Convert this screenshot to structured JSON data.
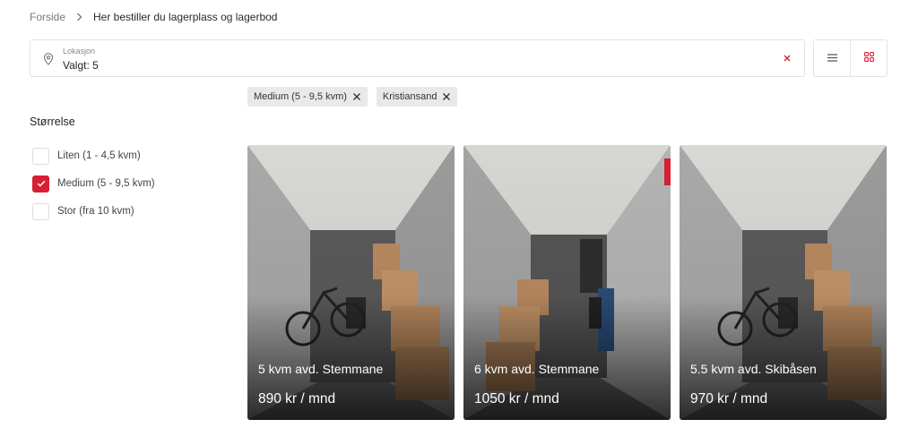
{
  "breadcrumb": {
    "home": "Forside",
    "separator_icon": "chevron-right-icon",
    "current": "Her bestiller du lagerplass og lagerbod"
  },
  "location": {
    "label": "Lokasjon",
    "value": "Valgt: 5",
    "icon": "map-pin-icon",
    "clear_icon": "close-icon"
  },
  "view_toggle": {
    "list_icon": "list-view-icon",
    "grid_icon": "grid-view-icon",
    "active": "grid"
  },
  "active_filters": [
    {
      "label": "Medium (5 - 9,5 kvm)"
    },
    {
      "label": "Kristiansand"
    }
  ],
  "size_filter": {
    "title": "Størrelse",
    "options": [
      {
        "label": "Liten (1 - 4,5 kvm)",
        "checked": false
      },
      {
        "label": "Medium (5 - 9,5 kvm)",
        "checked": true
      },
      {
        "label": "Stor (fra 10 kvm)",
        "checked": false
      }
    ]
  },
  "units": [
    {
      "title": "5 kvm avd. Stemmane",
      "price": "890 kr / mnd"
    },
    {
      "title": "6 kvm avd. Stemmane",
      "price": "1050 kr / mnd"
    },
    {
      "title": "5.5 kvm avd. Skibåsen",
      "price": "970 kr / mnd"
    }
  ],
  "colors": {
    "accent": "#d71f35",
    "chip_bg": "#e9e9e9",
    "border": "#e3e3e3"
  }
}
